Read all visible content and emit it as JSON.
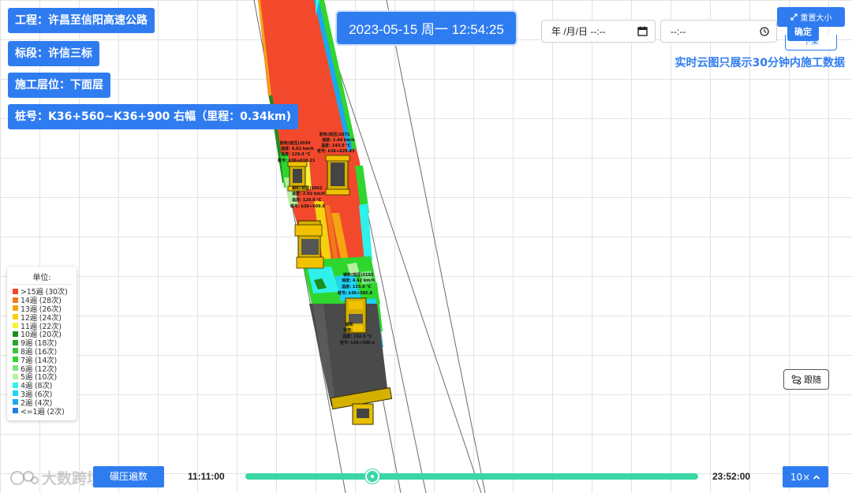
{
  "project": {
    "engineering": "工程：许昌至信阳高速公路",
    "section": "标段：许信三标",
    "layer": "施工层位：下面层",
    "stake": "桩号：K36+560~K36+900 右幅（里程：0.34km)"
  },
  "datetime": "2023-05-15 周一 12:54:25",
  "date_input": {
    "value": "年 /月/日 --:--",
    "icon": "calendar-icon"
  },
  "time_input": {
    "value": "--:--",
    "icon": "clock-icon"
  },
  "reset_label": "重置大小",
  "confirm_label": "确定",
  "confirm_back_label": "下架",
  "notice": "实时云图只展示30分钟内施工数据",
  "follow_label": "跟随",
  "legend": {
    "title": "单位:",
    "items": [
      {
        "label": ">15遍 (30次)",
        "color": "#f0452a"
      },
      {
        "label": "14遍 (28次)",
        "color": "#f07a1a"
      },
      {
        "label": "13遍 (26次)",
        "color": "#f5a512"
      },
      {
        "label": "12遍 (24次)",
        "color": "#f5d10f"
      },
      {
        "label": "11遍 (22次)",
        "color": "#f7f23d"
      },
      {
        "label": "10遍 (20次)",
        "color": "#1e8c1e"
      },
      {
        "label": "9遍 (18次)",
        "color": "#2aa52a"
      },
      {
        "label": "8遍 (16次)",
        "color": "#3cc43c"
      },
      {
        "label": "7遍 (14次)",
        "color": "#2ed62e"
      },
      {
        "label": "6遍 (12次)",
        "color": "#7ee37e"
      },
      {
        "label": "5遍 (10次)",
        "color": "#b5f0a0"
      },
      {
        "label": "4遍 (8次)",
        "color": "#2ff0ea"
      },
      {
        "label": "3遍 (6次)",
        "color": "#1fd3f5"
      },
      {
        "label": "2遍 (4次)",
        "color": "#1aa8f0"
      },
      {
        "label": "<=1遍 (2次)",
        "color": "#1e7fe0"
      }
    ]
  },
  "rollers": [
    {
      "line1": "胶轮(前压)2071",
      "line2": "速度: 2.44 km/h",
      "line3": "温度: 143.0 °C",
      "line4": "桩号: k36+629.83"
    },
    {
      "line1": "胶轮(前压)2030",
      "line2": "速度: 4.62 km/h",
      "line3": "温度: 129.0 °C",
      "line4": "桩号: k36+616.21"
    },
    {
      "line1": "钢轮(前压)2062",
      "line2": "速度: 2.02 km/h",
      "line3": "温度: 129.0 °C",
      "line4": "桩号: k36+609.8"
    },
    {
      "line1": "钢轮(前压)2102",
      "line2": "速度: 4.42 km/h",
      "line3": "温度: 133.0 °C",
      "line4": "桩号: k36+585.8"
    },
    {
      "line1": "钢轮",
      "line2": "速度:",
      "line3": "温度: 132.0 °C",
      "line4": "桩号: k36+580.4"
    }
  ],
  "mode_label": "碾压遍数",
  "watermark": "大数跨境",
  "timeline": {
    "start": "11:11:00",
    "end": "23:52:00",
    "progress": 0.28
  },
  "speed_label": "10×",
  "accent": "#2f7cf0"
}
